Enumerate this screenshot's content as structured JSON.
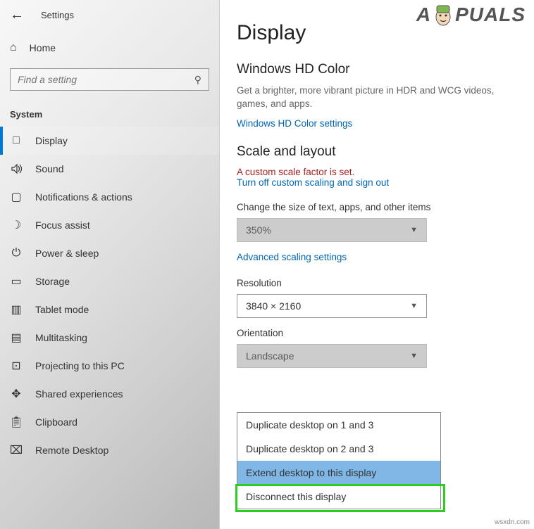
{
  "header": {
    "title": "Settings"
  },
  "sidebar": {
    "home": "Home",
    "search_placeholder": "Find a setting",
    "section": "System",
    "items": [
      {
        "label": "Display",
        "icon": "display"
      },
      {
        "label": "Sound",
        "icon": "sound"
      },
      {
        "label": "Notifications & actions",
        "icon": "notifications"
      },
      {
        "label": "Focus assist",
        "icon": "focus"
      },
      {
        "label": "Power & sleep",
        "icon": "power"
      },
      {
        "label": "Storage",
        "icon": "storage"
      },
      {
        "label": "Tablet mode",
        "icon": "tablet"
      },
      {
        "label": "Multitasking",
        "icon": "multitask"
      },
      {
        "label": "Projecting to this PC",
        "icon": "project"
      },
      {
        "label": "Shared experiences",
        "icon": "shared"
      },
      {
        "label": "Clipboard",
        "icon": "clipboard"
      },
      {
        "label": "Remote Desktop",
        "icon": "remote"
      }
    ]
  },
  "main": {
    "title": "Display",
    "hd_color": {
      "heading": "Windows HD Color",
      "desc": "Get a brighter, more vibrant picture in HDR and WCG videos, games, and apps.",
      "link": "Windows HD Color settings"
    },
    "scale": {
      "heading": "Scale and layout",
      "warning": "A custom scale factor is set.",
      "turnoff": "Turn off custom scaling and sign out",
      "size_label": "Change the size of text, apps, and other items",
      "size_value": "350%",
      "advanced": "Advanced scaling settings",
      "res_label": "Resolution",
      "res_value": "3840 × 2160",
      "orient_label": "Orientation",
      "orient_value": "Landscape"
    },
    "popup": {
      "items": [
        "Duplicate desktop on 1 and 3",
        "Duplicate desktop on 2 and 3",
        "Extend desktop to this display",
        "Disconnect this display"
      ]
    }
  },
  "watermark": {
    "pre": "A",
    "post": "PUALS"
  },
  "footer": "wsxdn.com"
}
